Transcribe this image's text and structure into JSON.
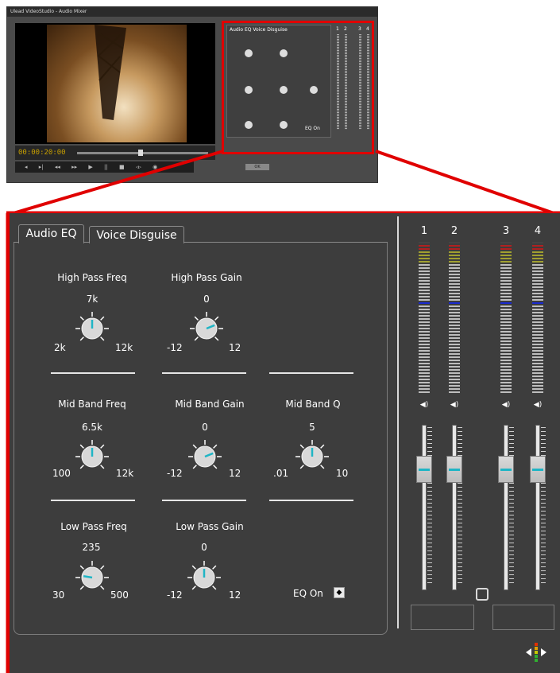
{
  "thumbnail": {
    "title": "Ulead VideoStudio - Audio Mixer",
    "timecode": "00:00:20:00",
    "mini_title": "Audio EQ  Voice Disguise",
    "mini_eq_on": "EQ On",
    "mini_channels": [
      "1",
      "2",
      "3",
      "4"
    ],
    "transport_buttons": [
      "◂",
      "▸|",
      "◂◂",
      "▸▸",
      "▶",
      "||",
      "■",
      "◃▹",
      "◉"
    ],
    "ok_label": "OK"
  },
  "tabs": [
    {
      "label": "Audio EQ",
      "active": true
    },
    {
      "label": "Voice Disguise",
      "active": false
    }
  ],
  "eq": {
    "rows": [
      [
        {
          "label": "High Pass Freq",
          "value": "7k",
          "min": "2k",
          "max": "12k",
          "level": 0.5
        },
        {
          "label": "High Pass Gain",
          "value": "0",
          "min": "-12",
          "max": "12",
          "level": 0.75
        }
      ],
      [
        {
          "label": "Mid Band Freq",
          "value": "6.5k",
          "min": "100",
          "max": "12k",
          "level": 0.5
        },
        {
          "label": "Mid Band Gain",
          "value": "0",
          "min": "-12",
          "max": "12",
          "level": 0.75
        },
        {
          "label": "Mid Band Q",
          "value": "5",
          "min": ".01",
          "max": "10",
          "level": 0.5
        }
      ],
      [
        {
          "label": "Low Pass Freq",
          "value": "235",
          "min": "30",
          "max": "500",
          "level": 0.2
        },
        {
          "label": "Low Pass Gain",
          "value": "0",
          "min": "-12",
          "max": "12",
          "level": 0.5
        }
      ]
    ],
    "eq_on_label": "EQ On",
    "eq_on_checked": true
  },
  "mixer": {
    "channels": [
      {
        "number": "1",
        "fader_level": 0.27
      },
      {
        "number": "2",
        "fader_level": 0.27
      },
      {
        "number": "3",
        "fader_level": 0.27
      },
      {
        "number": "4",
        "fader_level": 0.27
      }
    ]
  },
  "colors": {
    "accent_red": "#e00000",
    "meter_cyan": "#1fb5c5",
    "meter_blue": "#1a2ad0",
    "panel_bg": "#3d3d3d"
  },
  "icons": {
    "speaker": "speaker-icon",
    "pan": "pan-arrows-icon",
    "link": "link-toggle-icon"
  }
}
